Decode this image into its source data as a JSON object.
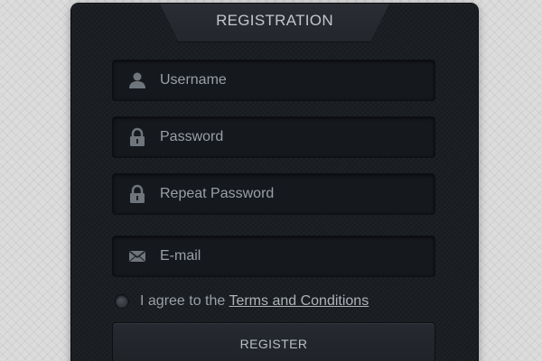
{
  "form": {
    "title": "REGISTRATION",
    "fields": [
      {
        "placeholder": "Username",
        "icon": "user-icon"
      },
      {
        "placeholder": "Password",
        "icon": "lock-icon"
      },
      {
        "placeholder": "Repeat Password",
        "icon": "lock-icon"
      },
      {
        "placeholder": "E-mail",
        "icon": "envelope-icon"
      }
    ],
    "agree": {
      "prefix": "I agree to the",
      "link": "Terms and Conditions"
    },
    "register_label": "REGISTER"
  },
  "colors": {
    "panel_background": "#1b1e22",
    "field_background": "#15181c",
    "text": "#9aa0a7",
    "page_background": "#dcdcdc"
  }
}
